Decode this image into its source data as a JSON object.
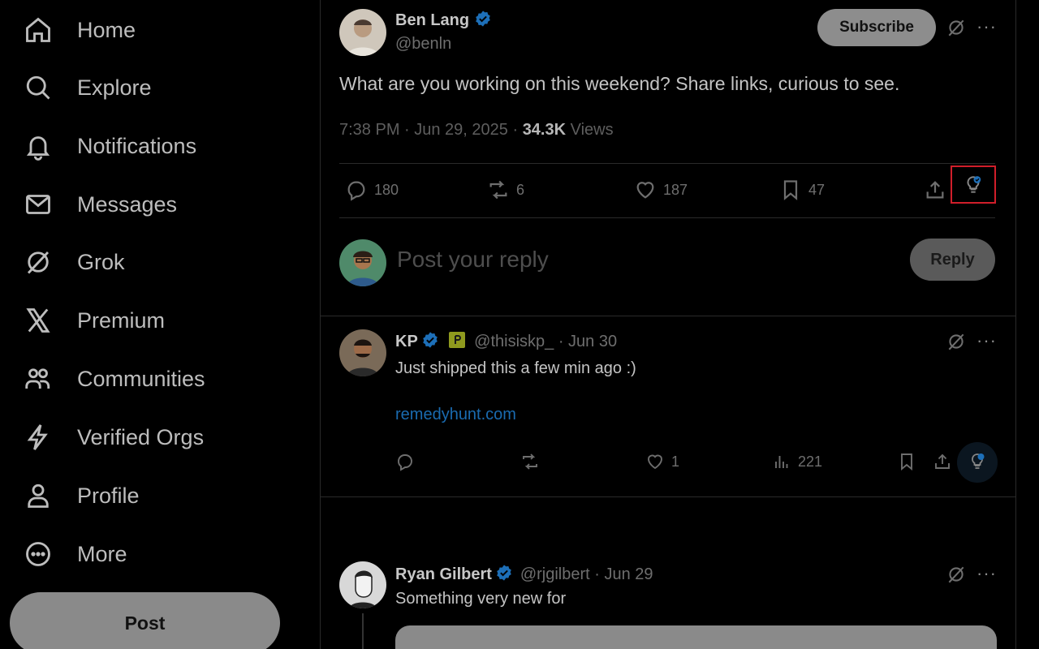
{
  "sidebar": {
    "items": [
      {
        "label": "Home",
        "icon": "home-icon"
      },
      {
        "label": "Explore",
        "icon": "search-icon"
      },
      {
        "label": "Notifications",
        "icon": "bell-icon"
      },
      {
        "label": "Messages",
        "icon": "envelope-icon"
      },
      {
        "label": "Grok",
        "icon": "grok-icon"
      },
      {
        "label": "Premium",
        "icon": "x-logo-icon"
      },
      {
        "label": "Communities",
        "icon": "people-icon"
      },
      {
        "label": "Verified Orgs",
        "icon": "lightning-icon"
      },
      {
        "label": "Profile",
        "icon": "person-icon"
      },
      {
        "label": "More",
        "icon": "more-circle-icon"
      }
    ],
    "post_label": "Post"
  },
  "main_post": {
    "name": "Ben Lang",
    "handle": "@benln",
    "subscribe_label": "Subscribe",
    "text": "What are you working on this weekend? Share links, curious to see.",
    "time": "7:38 PM · Jun 29, 2025 · ",
    "views_count": "34.3K",
    "views_label": " Views",
    "replies": "180",
    "reposts": "6",
    "likes": "187",
    "bookmarks": "47"
  },
  "composer": {
    "placeholder": "Post your reply",
    "reply_label": "Reply"
  },
  "replies": [
    {
      "name": "KP",
      "handle": "@thisiskp_ · Jun 30",
      "text": "Just shipped this a few min ago :)",
      "link": "remedyhunt.com",
      "replies": "",
      "reposts": "",
      "likes": "1",
      "views": "221"
    },
    {
      "name": "Ryan Gilbert",
      "handle": "@rjgilbert · Jun 29",
      "text": "Something very new for"
    }
  ],
  "colors": {
    "background": "#000000",
    "verified": "#1d6fb8",
    "link": "#1a6bb0",
    "highlight_box": "#d01e2a"
  }
}
